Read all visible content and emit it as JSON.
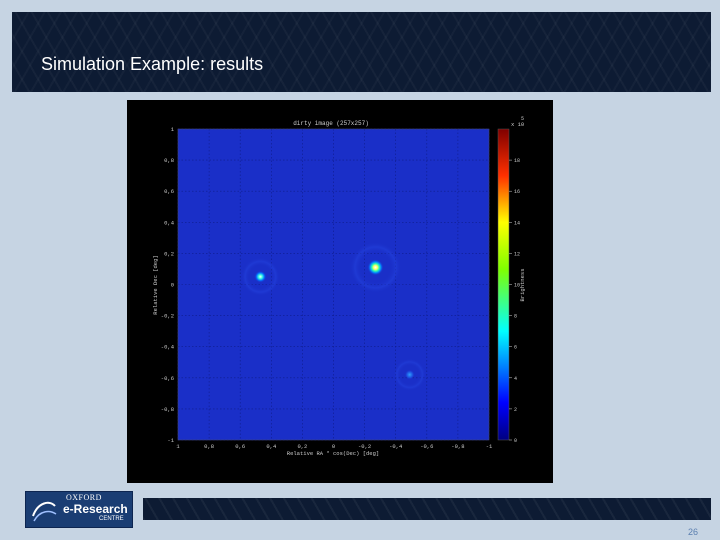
{
  "slide": {
    "title": "Simulation Example: results",
    "page_number": "26"
  },
  "logo": {
    "line1": "OXFORD",
    "line2": "e-Research",
    "line3": "CENTRE"
  },
  "colors": {
    "background": "#c6d4e3",
    "title_bar": "#0d1b33",
    "plot_field": "#1a2fc8",
    "accent": "#5b7fb0"
  },
  "chart_data": {
    "type": "heatmap",
    "title": "dirty image (257x257)",
    "xlabel": "Relative RA * cos(Dec) [deg]",
    "ylabel": "Relative Dec [deg]",
    "x_ticks": [
      "1",
      "0,8",
      "0,6",
      "0,4",
      "0,2",
      "0",
      "-0,2",
      "-0,4",
      "-0,6",
      "-0,8",
      "-1"
    ],
    "y_ticks": [
      "1",
      "0,8",
      "0,6",
      "0,4",
      "0,2",
      "0",
      "-0,2",
      "-0,4",
      "-0,6",
      "-0,8",
      "-1"
    ],
    "xlim": [
      1,
      -1
    ],
    "ylim": [
      -1,
      1
    ],
    "grid": true,
    "colorbar": {
      "label": "Brightness",
      "multiplier": "x 10",
      "exponent": "5",
      "ticks": [
        "18",
        "16",
        "14",
        "12",
        "10",
        "8",
        "6",
        "4",
        "2",
        "0"
      ],
      "range": [
        0,
        20
      ]
    },
    "sources": [
      {
        "x": 0.47,
        "y": 0.05,
        "brightness": 9
      },
      {
        "x": -0.27,
        "y": 0.11,
        "brightness": 17
      },
      {
        "x": -0.49,
        "y": -0.58,
        "brightness": 4
      }
    ]
  }
}
